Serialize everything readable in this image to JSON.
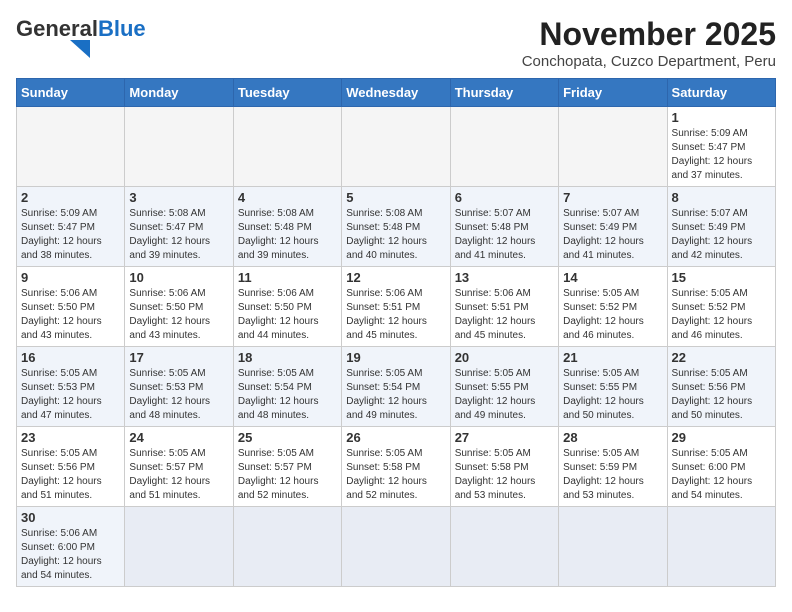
{
  "header": {
    "logo_general": "General",
    "logo_blue": "Blue",
    "month_year": "November 2025",
    "location": "Conchopata, Cuzco Department, Peru"
  },
  "days_of_week": [
    "Sunday",
    "Monday",
    "Tuesday",
    "Wednesday",
    "Thursday",
    "Friday",
    "Saturday"
  ],
  "weeks": [
    [
      {
        "day": "",
        "info": ""
      },
      {
        "day": "",
        "info": ""
      },
      {
        "day": "",
        "info": ""
      },
      {
        "day": "",
        "info": ""
      },
      {
        "day": "",
        "info": ""
      },
      {
        "day": "",
        "info": ""
      },
      {
        "day": "1",
        "info": "Sunrise: 5:09 AM\nSunset: 5:47 PM\nDaylight: 12 hours\nand 37 minutes."
      }
    ],
    [
      {
        "day": "2",
        "info": "Sunrise: 5:09 AM\nSunset: 5:47 PM\nDaylight: 12 hours\nand 38 minutes."
      },
      {
        "day": "3",
        "info": "Sunrise: 5:08 AM\nSunset: 5:47 PM\nDaylight: 12 hours\nand 39 minutes."
      },
      {
        "day": "4",
        "info": "Sunrise: 5:08 AM\nSunset: 5:48 PM\nDaylight: 12 hours\nand 39 minutes."
      },
      {
        "day": "5",
        "info": "Sunrise: 5:08 AM\nSunset: 5:48 PM\nDaylight: 12 hours\nand 40 minutes."
      },
      {
        "day": "6",
        "info": "Sunrise: 5:07 AM\nSunset: 5:48 PM\nDaylight: 12 hours\nand 41 minutes."
      },
      {
        "day": "7",
        "info": "Sunrise: 5:07 AM\nSunset: 5:49 PM\nDaylight: 12 hours\nand 41 minutes."
      },
      {
        "day": "8",
        "info": "Sunrise: 5:07 AM\nSunset: 5:49 PM\nDaylight: 12 hours\nand 42 minutes."
      }
    ],
    [
      {
        "day": "9",
        "info": "Sunrise: 5:06 AM\nSunset: 5:50 PM\nDaylight: 12 hours\nand 43 minutes."
      },
      {
        "day": "10",
        "info": "Sunrise: 5:06 AM\nSunset: 5:50 PM\nDaylight: 12 hours\nand 43 minutes."
      },
      {
        "day": "11",
        "info": "Sunrise: 5:06 AM\nSunset: 5:50 PM\nDaylight: 12 hours\nand 44 minutes."
      },
      {
        "day": "12",
        "info": "Sunrise: 5:06 AM\nSunset: 5:51 PM\nDaylight: 12 hours\nand 45 minutes."
      },
      {
        "day": "13",
        "info": "Sunrise: 5:06 AM\nSunset: 5:51 PM\nDaylight: 12 hours\nand 45 minutes."
      },
      {
        "day": "14",
        "info": "Sunrise: 5:05 AM\nSunset: 5:52 PM\nDaylight: 12 hours\nand 46 minutes."
      },
      {
        "day": "15",
        "info": "Sunrise: 5:05 AM\nSunset: 5:52 PM\nDaylight: 12 hours\nand 46 minutes."
      }
    ],
    [
      {
        "day": "16",
        "info": "Sunrise: 5:05 AM\nSunset: 5:53 PM\nDaylight: 12 hours\nand 47 minutes."
      },
      {
        "day": "17",
        "info": "Sunrise: 5:05 AM\nSunset: 5:53 PM\nDaylight: 12 hours\nand 48 minutes."
      },
      {
        "day": "18",
        "info": "Sunrise: 5:05 AM\nSunset: 5:54 PM\nDaylight: 12 hours\nand 48 minutes."
      },
      {
        "day": "19",
        "info": "Sunrise: 5:05 AM\nSunset: 5:54 PM\nDaylight: 12 hours\nand 49 minutes."
      },
      {
        "day": "20",
        "info": "Sunrise: 5:05 AM\nSunset: 5:55 PM\nDaylight: 12 hours\nand 49 minutes."
      },
      {
        "day": "21",
        "info": "Sunrise: 5:05 AM\nSunset: 5:55 PM\nDaylight: 12 hours\nand 50 minutes."
      },
      {
        "day": "22",
        "info": "Sunrise: 5:05 AM\nSunset: 5:56 PM\nDaylight: 12 hours\nand 50 minutes."
      }
    ],
    [
      {
        "day": "23",
        "info": "Sunrise: 5:05 AM\nSunset: 5:56 PM\nDaylight: 12 hours\nand 51 minutes."
      },
      {
        "day": "24",
        "info": "Sunrise: 5:05 AM\nSunset: 5:57 PM\nDaylight: 12 hours\nand 51 minutes."
      },
      {
        "day": "25",
        "info": "Sunrise: 5:05 AM\nSunset: 5:57 PM\nDaylight: 12 hours\nand 52 minutes."
      },
      {
        "day": "26",
        "info": "Sunrise: 5:05 AM\nSunset: 5:58 PM\nDaylight: 12 hours\nand 52 minutes."
      },
      {
        "day": "27",
        "info": "Sunrise: 5:05 AM\nSunset: 5:58 PM\nDaylight: 12 hours\nand 53 minutes."
      },
      {
        "day": "28",
        "info": "Sunrise: 5:05 AM\nSunset: 5:59 PM\nDaylight: 12 hours\nand 53 minutes."
      },
      {
        "day": "29",
        "info": "Sunrise: 5:05 AM\nSunset: 6:00 PM\nDaylight: 12 hours\nand 54 minutes."
      }
    ],
    [
      {
        "day": "30",
        "info": "Sunrise: 5:06 AM\nSunset: 6:00 PM\nDaylight: 12 hours\nand 54 minutes."
      },
      {
        "day": "",
        "info": ""
      },
      {
        "day": "",
        "info": ""
      },
      {
        "day": "",
        "info": ""
      },
      {
        "day": "",
        "info": ""
      },
      {
        "day": "",
        "info": ""
      },
      {
        "day": "",
        "info": ""
      }
    ]
  ]
}
